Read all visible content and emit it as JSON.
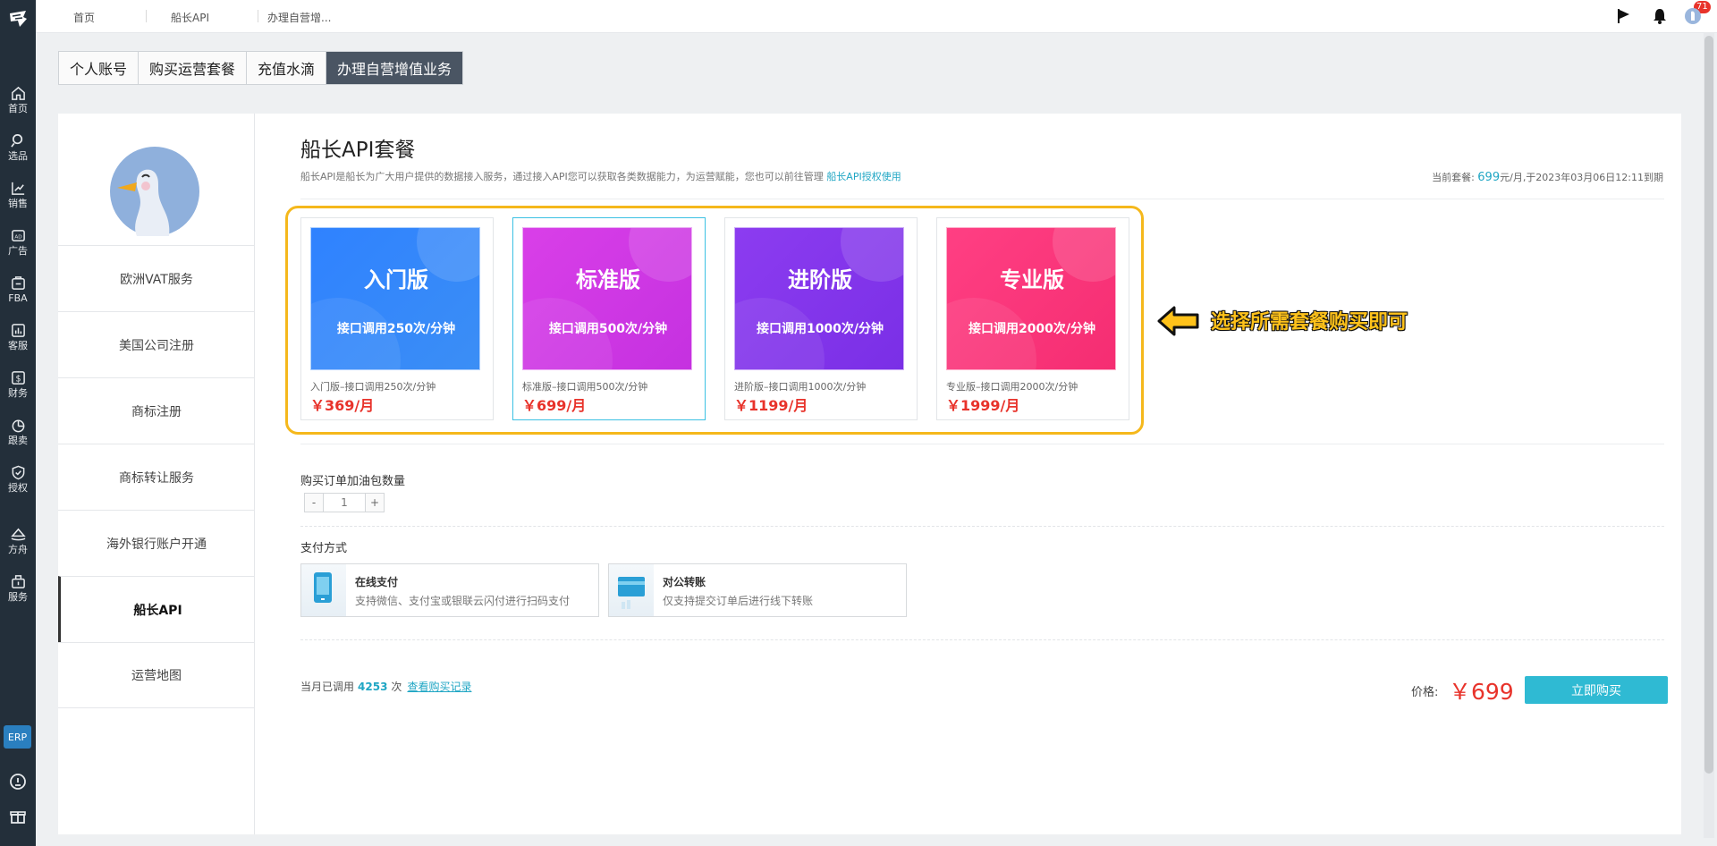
{
  "nav": {
    "items": [
      {
        "label": "首页",
        "icon": "home-icon"
      },
      {
        "label": "选品",
        "icon": "search-icon"
      },
      {
        "label": "销售",
        "icon": "trend-chart-icon"
      },
      {
        "label": "广告",
        "icon": "ad-icon"
      },
      {
        "label": "FBA",
        "icon": "fba-icon"
      },
      {
        "label": "客服",
        "icon": "bar-chart-icon"
      },
      {
        "label": "财务",
        "icon": "dollar-icon"
      },
      {
        "label": "跟卖",
        "icon": "pie-chart-icon"
      },
      {
        "label": "授权",
        "icon": "shield-icon"
      },
      {
        "label": "方舟",
        "icon": "ark-icon"
      },
      {
        "label": "服务",
        "icon": "service-icon"
      }
    ],
    "erp_label": "ERP"
  },
  "breadcrumbs": [
    "首页",
    "船长API",
    "办理自营增..."
  ],
  "notifications": {
    "count": "71"
  },
  "tabs": [
    "个人账号",
    "购买运营套餐",
    "充值水滴",
    "办理自营增值业务"
  ],
  "sidebar": {
    "items": [
      "欧洲VAT服务",
      "美国公司注册",
      "商标注册",
      "商标转让服务",
      "海外银行账户开通",
      "船长API",
      "运营地图"
    ],
    "active": "船长API"
  },
  "main": {
    "title": "船长API套餐",
    "description": "船长API是船长为广大用户提供的数据接入服务，通过接入API您可以获取各类数据能力，为运营赋能，您也可以前往管理",
    "description_link": "船长API授权使用",
    "current_prefix": "当前套餐: ",
    "current_price": "699",
    "current_suffix": "元/月,于2023年03月06日12:11到期"
  },
  "plans": [
    {
      "name": "入门版",
      "rate": "接口调用250次/分钟",
      "desc": "入门版–接口调用250次/分钟",
      "price": "￥369/月",
      "color_from": "#2f82ff",
      "color_to": "#3b8ef5"
    },
    {
      "name": "标准版",
      "rate": "接口调用500次/分钟",
      "desc": "标准版–接口调用500次/分钟",
      "price": "￥699/月",
      "color_from": "#d93fe8",
      "color_to": "#c531e0"
    },
    {
      "name": "进阶版",
      "rate": "接口调用1000次/分钟",
      "desc": "进阶版–接口调用1000次/分钟",
      "price": "￥1199/月",
      "color_from": "#8c3cf0",
      "color_to": "#7a2fe6"
    },
    {
      "name": "专业版",
      "rate": "接口调用2000次/分钟",
      "desc": "专业版–接口调用2000次/分钟",
      "price": "￥1999/月",
      "color_from": "#ff3f83",
      "color_to": "#f52d72"
    }
  ],
  "callout": "选择所需套餐购买即可",
  "addon": {
    "label": "购买订单加油包数量",
    "value": "1",
    "minus": "-",
    "plus": "+"
  },
  "payment": {
    "label": "支付方式",
    "options": [
      {
        "name": "在线支付",
        "sub": "支持微信、支付宝或银联云闪付进行扫码支付"
      },
      {
        "name": "对公转账",
        "sub": "仅支持提交订单后进行线下转账"
      }
    ]
  },
  "usage": {
    "prefix": "当月已调用",
    "count": "4253",
    "unit": "次",
    "link": "查看购买记录"
  },
  "price": {
    "label": "价格:",
    "value": "￥699"
  },
  "buy_label": "立即购买",
  "colors": {
    "accent": "#2fbad3",
    "price_red": "#e8332b",
    "highlight": "#f5b81c",
    "rail": "#232f3a"
  }
}
